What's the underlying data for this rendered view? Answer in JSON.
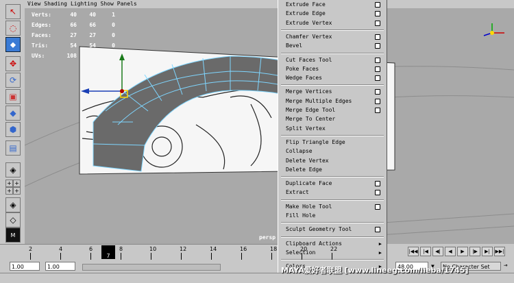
{
  "viewport_menu": [
    "View",
    "Shading",
    "Lighting",
    "Show",
    "Panels"
  ],
  "hud": [
    {
      "label": "Verts:",
      "a": "40",
      "b": "40",
      "c": "1"
    },
    {
      "label": "Edges:",
      "a": "66",
      "b": "66",
      "c": "0"
    },
    {
      "label": "Faces:",
      "a": "27",
      "b": "27",
      "c": "0"
    },
    {
      "label": "Tris:",
      "a": "54",
      "b": "54",
      "c": "0"
    },
    {
      "label": "UVs:",
      "a": "108",
      "b": "",
      "c": ""
    }
  ],
  "camera_label": "persp",
  "context_menu": {
    "groups": [
      [
        {
          "label": "Extrude Face",
          "opt": true
        },
        {
          "label": "Extrude Edge",
          "opt": true
        },
        {
          "label": "Extrude Vertex",
          "opt": true
        }
      ],
      [
        {
          "label": "Chamfer Vertex",
          "opt": true
        },
        {
          "label": "Bevel",
          "opt": true
        }
      ],
      [
        {
          "label": "Cut Faces Tool",
          "opt": true
        },
        {
          "label": "Poke Faces",
          "opt": true
        },
        {
          "label": "Wedge Faces",
          "opt": true
        }
      ],
      [
        {
          "label": "Merge Vertices",
          "opt": true
        },
        {
          "label": "Merge Multiple Edges",
          "opt": true
        },
        {
          "label": "Merge Edge Tool",
          "opt": true
        },
        {
          "label": "Merge To Center",
          "opt": false
        },
        {
          "label": "Split Vertex",
          "opt": false
        }
      ],
      [
        {
          "label": "Flip Triangle Edge",
          "opt": false
        },
        {
          "label": "Collapse",
          "opt": false
        },
        {
          "label": "Delete Vertex",
          "opt": false
        },
        {
          "label": "Delete Edge",
          "opt": false
        }
      ],
      [
        {
          "label": "Duplicate Face",
          "opt": true
        },
        {
          "label": "Extract",
          "opt": true
        }
      ],
      [
        {
          "label": "Make Hole Tool",
          "opt": true
        },
        {
          "label": "Fill Hole",
          "opt": false
        }
      ],
      [
        {
          "label": "Sculpt Geometry Tool",
          "opt": true
        }
      ],
      [
        {
          "label": "Clipboard Actions",
          "sub": true
        },
        {
          "label": "Selection",
          "sub": true
        }
      ],
      [
        {
          "label": "Colors",
          "sub": true
        }
      ]
    ]
  },
  "timeline": {
    "ticks": [
      "2",
      "4",
      "6",
      "8",
      "10",
      "12",
      "14",
      "16",
      "18",
      "20",
      "22"
    ],
    "current_frame": "7",
    "start": "1.00",
    "range_start": "1.00",
    "end": "48.00",
    "char_set": "No Character Set"
  },
  "watermark": "MAYA爱好者联盟   [www.lineeg.com/lieba/1745]",
  "colors": {
    "selected_tool": "#3a7bd5",
    "mesh_face": "#6a6a6a",
    "mesh_edge": "#7fd6ff"
  }
}
